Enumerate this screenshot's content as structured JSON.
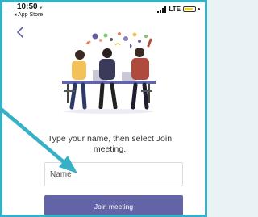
{
  "status_bar": {
    "time": "10:50",
    "back_app": "◂ App Store",
    "network": "LTE",
    "battery_color": "#f5cf16"
  },
  "nav": {
    "back_icon": "chevron-left-icon"
  },
  "illustration": {
    "icon": "meeting-people-illustration"
  },
  "join": {
    "instruction": "Type your name, then select Join meeting.",
    "name_placeholder": "Name",
    "name_value": "",
    "button_label": "Join meeting",
    "accent_color": "#6264a7"
  },
  "annotation": {
    "arrow_color": "#35b0c6"
  }
}
